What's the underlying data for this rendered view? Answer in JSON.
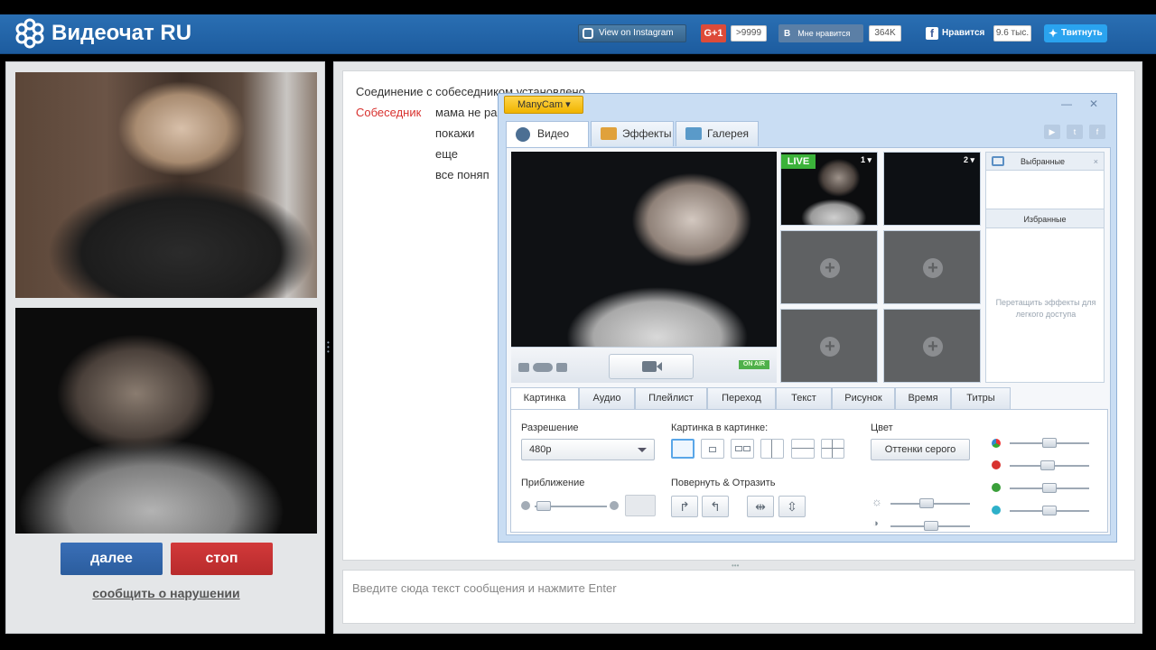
{
  "header": {
    "logo_text": "Видеочат RU",
    "instagram_label": "View on Instagram",
    "gplus_label": "G+1",
    "gplus_count": ">9999",
    "vk_label": "В",
    "vk_like_label": "Мне нравится",
    "vk_count": "364K",
    "fb_label": "Нравится",
    "fb_count": "9.6 тыс.",
    "twitter_label": "Твитнуть"
  },
  "left": {
    "next_label": "далее",
    "stop_label": "стоп",
    "report_label": "сообщить о нарушении"
  },
  "chat": {
    "system_message": "Соединение с собеседником установлено",
    "sender_label": "Собеседник",
    "messages": [
      "мама не ра",
      "покажи",
      "еще",
      "все поняп"
    ],
    "input_placeholder": "Введите сюда текст сообщения и нажмите Enter"
  },
  "manycam": {
    "menu_label": "ManyCam",
    "tabs": [
      "Видео",
      "Эффекты",
      "Галерея"
    ],
    "live_label": "LIVE",
    "slot1_num": "1",
    "slot2_num": "2",
    "onair_label": "ON AIR",
    "fav_title": "Выбранные",
    "fav_title2": "Избранные",
    "fav_hint": "Перетащить эффекты для легкого доступа",
    "ctrl_tabs": [
      "Картинка",
      "Аудио",
      "Плейлист",
      "Переход",
      "Текст",
      "Рисунок",
      "Время",
      "Титры"
    ],
    "resolution_label": "Разрешение",
    "resolution_value": "480p",
    "pip_label": "Картинка в картинке:",
    "color_label": "Цвет",
    "grayscale_label": "Оттенки серого",
    "zoom_label": "Приближение",
    "rotate_label": "Повернуть & Отразить"
  },
  "colors": {
    "header_blue": "#2a6fb3",
    "next_blue": "#3a6fb7",
    "stop_red": "#d2393a",
    "sender_red": "#d8322f",
    "live_green": "#3bb23a"
  }
}
